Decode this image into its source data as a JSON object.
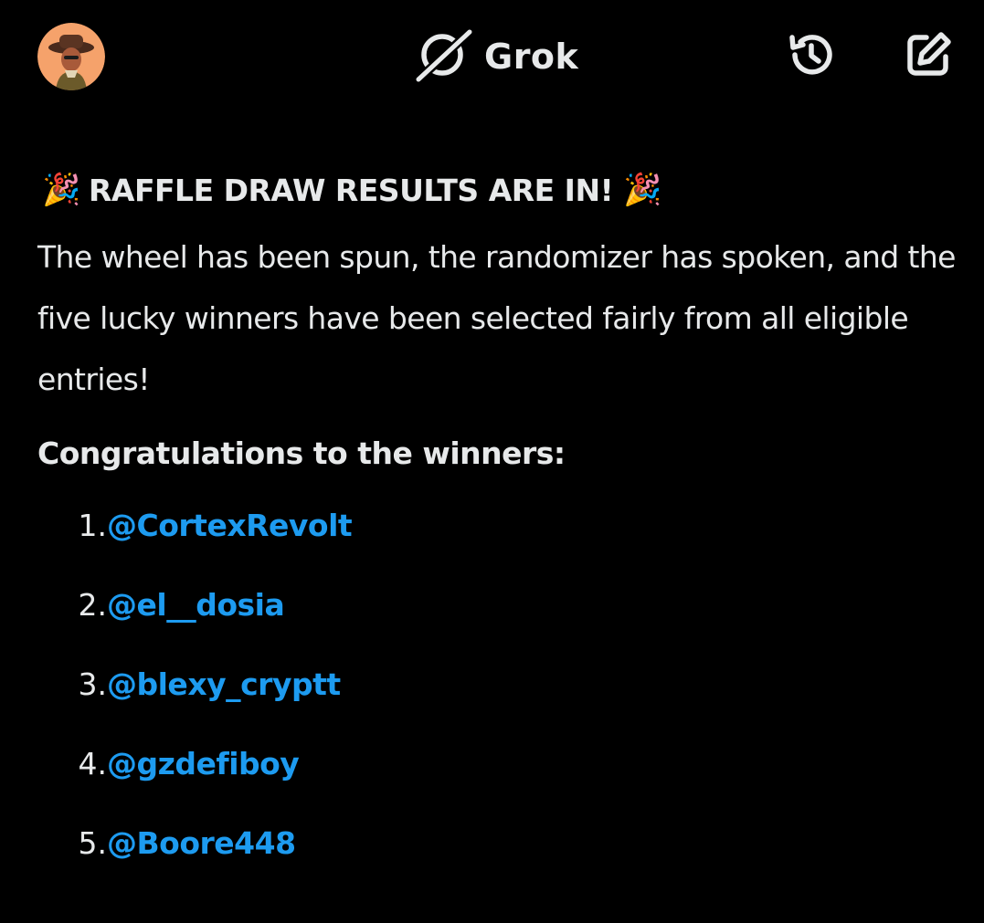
{
  "header": {
    "title": "Grok",
    "logo_icon": "grok-logo-icon",
    "history_icon": "history-icon",
    "compose_icon": "compose-icon",
    "avatar_icon": "user-avatar"
  },
  "message": {
    "headline_emoji": "🎉",
    "headline": "RAFFLE DRAW RESULTS ARE IN!",
    "paragraph": "The wheel has been spun, the randomizer has spoken, and the five lucky winners have been selected fairly from all eligible entries!",
    "subheading": "Congratulations to the winners:",
    "winners": [
      {
        "number": "1.",
        "handle": "@CortexRevolt"
      },
      {
        "number": "2.",
        "handle": "@el__dosia"
      },
      {
        "number": "3.",
        "handle": "@blexy_cryptt"
      },
      {
        "number": "4.",
        "handle": "@gzdefiboy"
      },
      {
        "number": "5.",
        "handle": "@Boore448"
      }
    ]
  },
  "colors": {
    "background": "#000000",
    "text": "#e7e9ea",
    "link": "#1d9bf0"
  }
}
